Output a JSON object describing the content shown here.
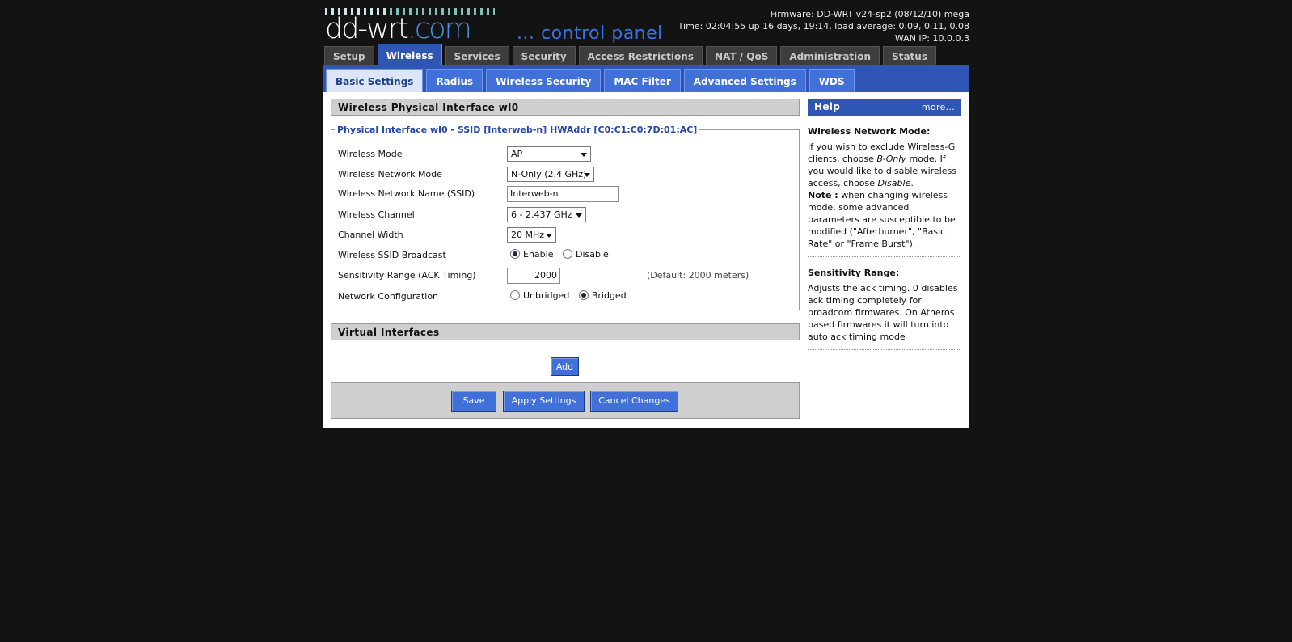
{
  "header": {
    "logo_text": "dd-wrt",
    "logo_suffix": ".com",
    "subtitle": "... control panel",
    "firmware": "Firmware: DD-WRT v24-sp2 (08/12/10) mega",
    "time": "Time: 02:04:55 up 16 days, 19:14, load average: 0.09, 0.11, 0.08",
    "wan_ip": "WAN IP: 10.0.0.3"
  },
  "tabs": [
    "Setup",
    "Wireless",
    "Services",
    "Security",
    "Access Restrictions",
    "NAT / QoS",
    "Administration",
    "Status"
  ],
  "active_tab": "Wireless",
  "subtabs": [
    "Basic Settings",
    "Radius",
    "Wireless Security",
    "MAC Filter",
    "Advanced Settings",
    "WDS"
  ],
  "active_subtab": "Basic Settings",
  "section": {
    "title": "Wireless Physical Interface wl0",
    "legend": "Physical Interface wl0 - SSID [Interweb-n] HWAddr [C0:C1:C0:7D:01:AC]",
    "fields": {
      "wireless_mode": {
        "label": "Wireless Mode",
        "value": "AP"
      },
      "network_mode": {
        "label": "Wireless Network Mode",
        "value": "N-Only (2.4 GHz)"
      },
      "ssid": {
        "label": "Wireless Network Name (SSID)",
        "value": "Interweb-n"
      },
      "channel": {
        "label": "Wireless Channel",
        "value": "6 - 2.437 GHz"
      },
      "channel_width": {
        "label": "Channel Width",
        "value": "20 MHz"
      },
      "ssid_broadcast": {
        "label": "Wireless SSID Broadcast",
        "opt1": "Enable",
        "opt2": "Disable",
        "selected": "Enable"
      },
      "sensitivity": {
        "label": "Sensitivity Range (ACK Timing)",
        "value": "2000",
        "hint": "(Default: 2000 meters)"
      },
      "net_config": {
        "label": "Network Configuration",
        "opt1": "Unbridged",
        "opt2": "Bridged",
        "selected": "Bridged"
      }
    }
  },
  "virtual": {
    "title": "Virtual Interfaces",
    "add_label": "Add"
  },
  "buttons": {
    "save": "Save",
    "apply": "Apply Settings",
    "cancel": "Cancel Changes"
  },
  "help": {
    "title": "Help",
    "more": "more...",
    "mode_title": "Wireless Network Mode:",
    "mode_p1a": "If you wish to exclude Wireless-G clients, choose ",
    "mode_p1b": "B-Only",
    "mode_p1c": " mode. If you would like to disable wireless access, choose ",
    "mode_p1d": "Disable",
    "mode_p1e": ".",
    "note_label": "Note :",
    "note_text": " when changing wireless mode, some advanced parameters are susceptible to be modified (\"Afterburner\", \"Basic Rate\" or \"Frame Burst\").",
    "sens_title": "Sensitivity Range:",
    "sens_text": "Adjusts the ack timing. 0 disables ack timing completely for broadcom firmwares. On Atheros based firmwares it will turn into auto ack timing mode"
  }
}
